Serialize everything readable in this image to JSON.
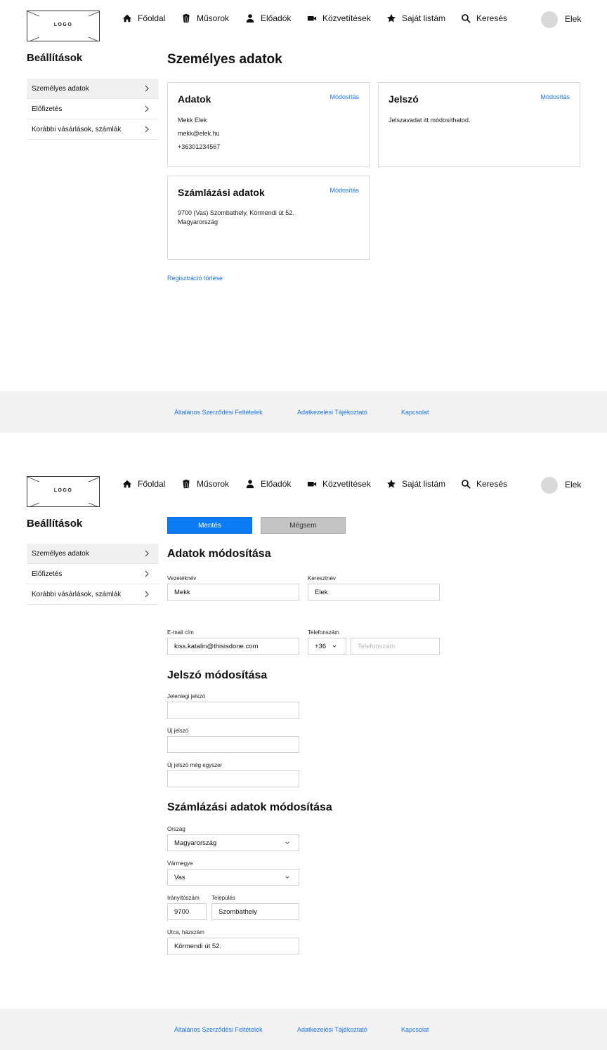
{
  "header": {
    "logo_text": "LOGO",
    "nav": [
      {
        "label": "Főoldal",
        "icon": "home-icon"
      },
      {
        "label": "Műsorok",
        "icon": "popcorn-icon"
      },
      {
        "label": "Előadók",
        "icon": "person-icon"
      },
      {
        "label": "Közvetítések",
        "icon": "video-camera-icon"
      },
      {
        "label": "Saját listám",
        "icon": "star-icon"
      },
      {
        "label": "Keresés",
        "icon": "search-icon"
      }
    ],
    "user_name": "Elek"
  },
  "sidebar": {
    "title": "Beállítások",
    "items": [
      {
        "label": "Személyes adatok",
        "active": true
      },
      {
        "label": "Előfizetés",
        "active": false
      },
      {
        "label": "Korábbi vásárlások, számlák",
        "active": false
      }
    ]
  },
  "overview": {
    "title": "Személyes adatok",
    "edit_label": "Módosítás",
    "data_card": {
      "title": "Adatok",
      "lines": [
        "Mekk Elek",
        "mekk@elek.hu",
        "+36301234567"
      ]
    },
    "password_card": {
      "title": "Jelszó",
      "text": "Jelszavadat itt módosíthatod."
    },
    "billing_card": {
      "title": "Számlázási adatok",
      "lines": [
        "9700 (Vas) Szombathely, Körmendi út 52.",
        "Magyarország"
      ]
    },
    "delete_link": "Regisztráció törlése"
  },
  "footer": {
    "links": [
      "Általános Szerződési Feltételek",
      "Adatkezelési Tájékoztató",
      "Kapcsolat"
    ]
  },
  "edit_form": {
    "save_label": "Mentés",
    "cancel_label": "Mégsem",
    "data_section": {
      "title": "Adatok módosítása",
      "last_name_label": "Vezetéknév",
      "last_name_value": "Mekk",
      "first_name_label": "Keresztnév",
      "first_name_value": "Elek",
      "email_label": "E-mail cím",
      "email_value": "kiss.katalin@thisisdone.com",
      "phone_label": "Telefonszám",
      "phone_prefix": "+36",
      "phone_placeholder": "Telefonszám"
    },
    "password_section": {
      "title": "Jelszó módosítása",
      "current_label": "Jelenlegi jelszó",
      "new_label": "Új jelszó",
      "repeat_label": "Új jelszó még egyszer"
    },
    "billing_section": {
      "title": "Számlázási adatok módosítása",
      "country_label": "Ország",
      "country_value": "Magyarország",
      "county_label": "Vármegye",
      "county_value": "Vas",
      "zip_label": "Irányítószám",
      "zip_value": "9700",
      "city_label": "Település",
      "city_value": "Szombathely",
      "street_label": "Utca, házszám",
      "street_value": "Körmendi út 52."
    }
  }
}
